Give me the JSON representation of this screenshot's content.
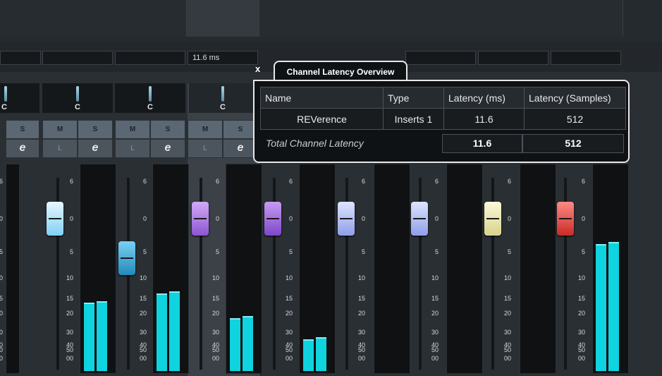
{
  "overlay": {
    "close_label": "x",
    "title": "Channel Latency Overview",
    "columns": [
      "Name",
      "Type",
      "Latency (ms)",
      "Latency (Samples)"
    ],
    "rows": [
      {
        "name": "REVerence",
        "type": "Inserts 1",
        "ms": "11.6",
        "samples": "512"
      }
    ],
    "total_label": "Total Channel Latency",
    "total_ms": "11.6",
    "total_samples": "512"
  },
  "latency_display": "11.6 ms",
  "channel_buttons": {
    "mute": "M",
    "solo": "S",
    "listen": "L",
    "edit": "e",
    "pan": "C"
  },
  "scale_labels": [
    "6",
    "0",
    "5",
    "10",
    "15",
    "20",
    "30",
    "40",
    "50",
    "00"
  ],
  "colors": {
    "meter": "#0fd3de",
    "fader_caps": [
      "#bfe8fb",
      "#4cb4e0",
      "#b07ee9",
      "#a86de0",
      "#b6c3f5",
      "#b6c3f5",
      "#f2efbe",
      "#ea4f4a"
    ]
  },
  "meter_levels": [
    0.35,
    0.4,
    0.27,
    0.16,
    0.66
  ]
}
